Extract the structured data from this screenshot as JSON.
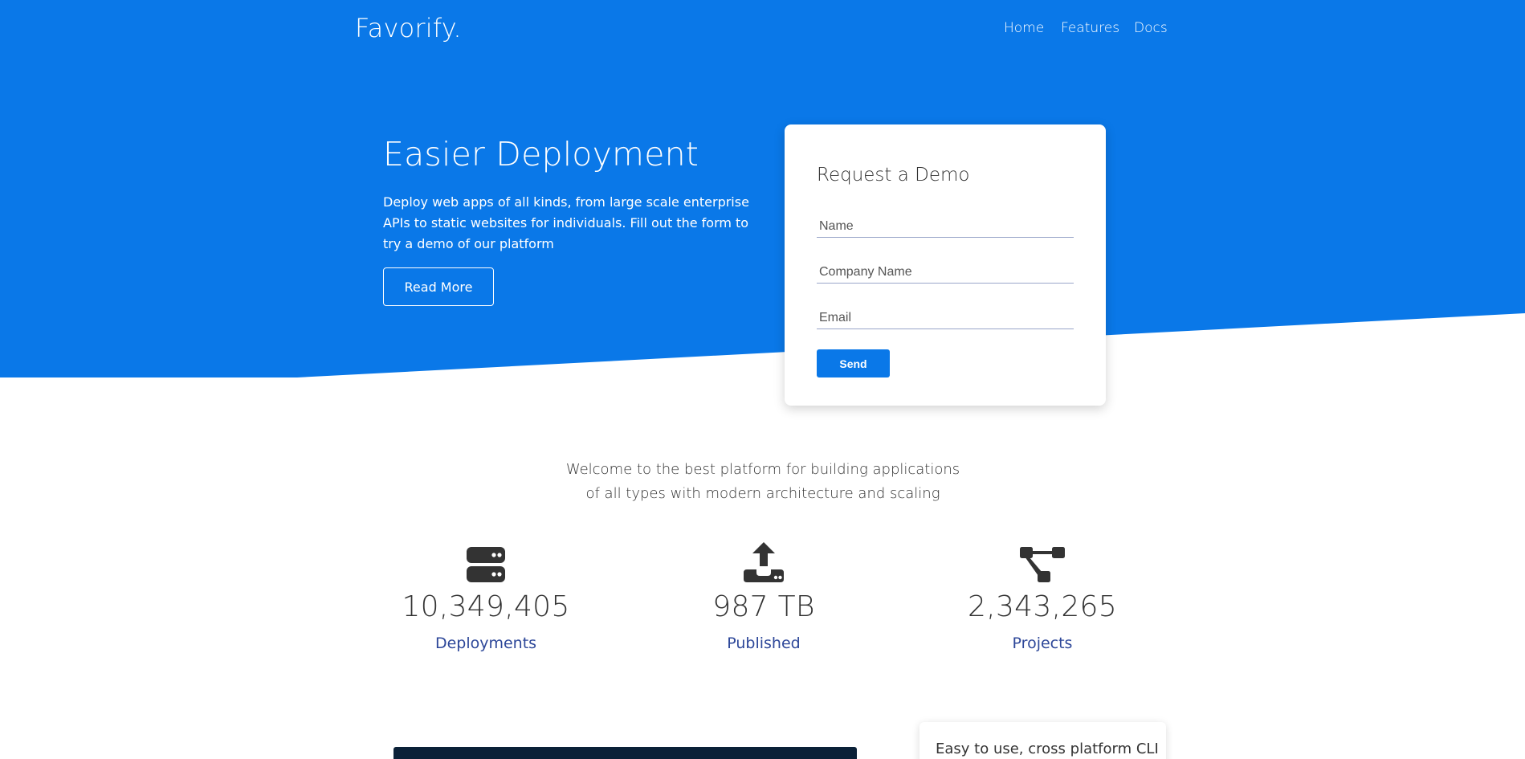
{
  "colors": {
    "hero_blue": "#0a78e8",
    "link_blue": "#2d4799",
    "dark": "#333333"
  },
  "navbar": {
    "brand": "Favorify.",
    "links": [
      {
        "label": "Home"
      },
      {
        "label": "Features"
      },
      {
        "label": "Docs"
      }
    ]
  },
  "hero": {
    "title": "Easier Deployment",
    "text": "Deploy web apps of all kinds, from large scale enterprise APIs to static websites for individuals. Fill out the form to try a demo of our platform",
    "button_label": "Read More"
  },
  "demo_form": {
    "title": "Request a Demo",
    "name_placeholder": "Name",
    "company_placeholder": "Company Name",
    "email_placeholder": "Email",
    "send_label": "Send"
  },
  "welcome_text": "Welcome to the best platform for building applications of all types with modern architecture and scaling",
  "stats": [
    {
      "icon": "server-icon",
      "value": "10,349,405",
      "label": "Deployments"
    },
    {
      "icon": "upload-icon",
      "value": "987 TB",
      "label": "Published"
    },
    {
      "icon": "project-diagram-icon",
      "value": "2,343,265",
      "label": "Projects"
    }
  ],
  "cli_card": {
    "text": "Easy to use, cross platform CLI"
  }
}
